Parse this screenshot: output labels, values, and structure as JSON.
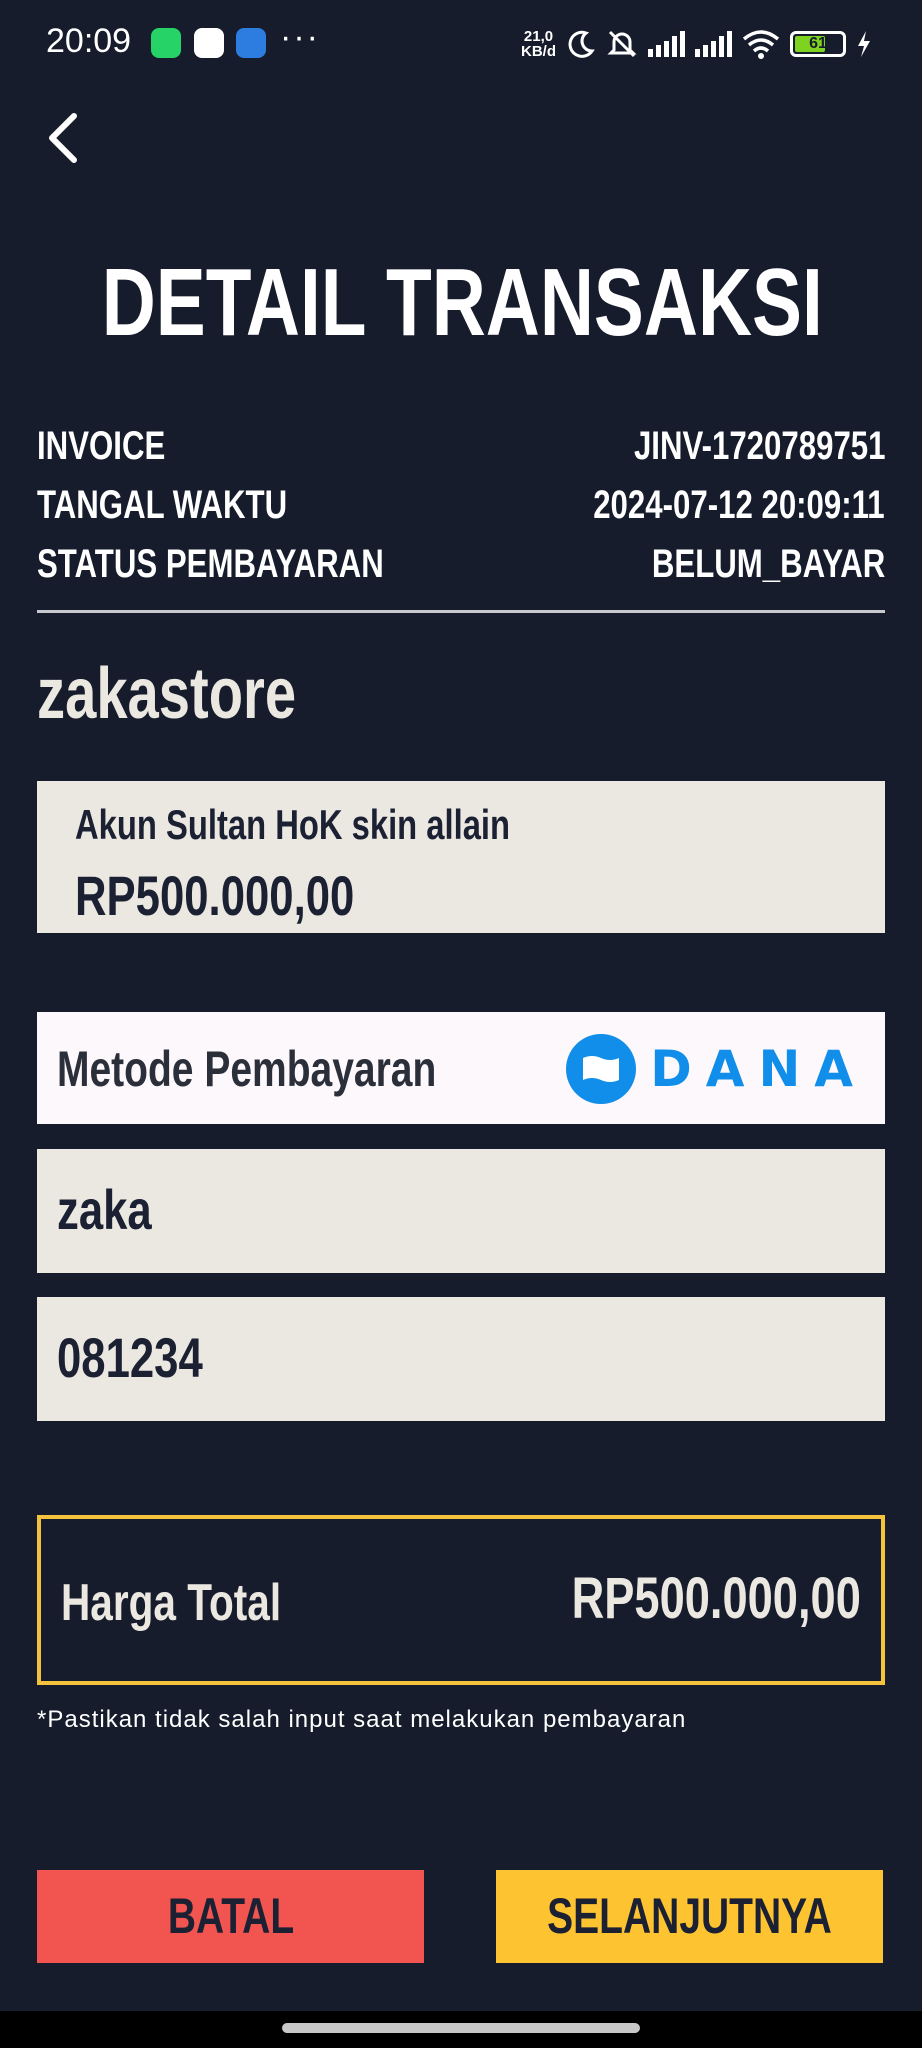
{
  "status_bar": {
    "time": "20:09",
    "net_speed_value": "21,0",
    "net_speed_unit": "KB/d",
    "battery": "61",
    "icons": [
      "whatsapp-icon",
      "google-icon",
      "app-icon",
      "moon-icon",
      "bell-off-icon",
      "signal-icon",
      "signal-icon",
      "wifi-icon",
      "battery-icon",
      "charging-icon"
    ]
  },
  "header": {
    "title": "DETAIL TRANSAKSI"
  },
  "info": {
    "invoice_label": "INVOICE",
    "invoice_value": "JINV-1720789751",
    "datetime_label": "TANGAL WAKTU",
    "datetime_value": "2024-07-12 20:09:11",
    "status_label": "STATUS PEMBAYARAN",
    "status_value": "BELUM_BAYAR"
  },
  "store": {
    "name": "zakastore"
  },
  "product": {
    "name": "Akun Sultan HoK skin allain",
    "price": "RP500.000,00"
  },
  "payment": {
    "label": "Metode Pembayaran",
    "method": "DANA"
  },
  "fields": {
    "name": "zaka",
    "phone": "081234"
  },
  "total": {
    "label": "Harga Total",
    "value": "RP500.000,00"
  },
  "note": "*Pastikan tidak salah input saat melakukan pembayaran",
  "buttons": {
    "cancel": "BATAL",
    "next": "SELANJUTNYA"
  },
  "colors": {
    "background": "#161c2b",
    "cancel": "#f25450",
    "next": "#fec330",
    "total_border": "#f5c33b",
    "dana_blue": "#118ee9"
  }
}
